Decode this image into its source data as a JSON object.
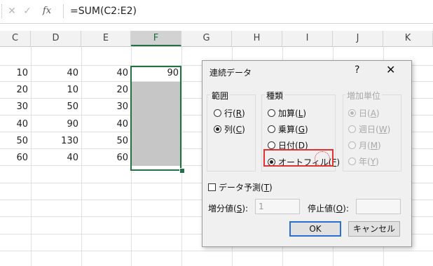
{
  "formula_bar": {
    "cancel_icon": "x-icon",
    "enter_icon": "check-icon",
    "fx_label": "fx",
    "formula": "=SUM(C2:E2)"
  },
  "columns": [
    "C",
    "D",
    "E",
    "F",
    "G",
    "H",
    "I",
    "J",
    "K"
  ],
  "selected_column": "F",
  "rows": [
    {
      "c": "10",
      "d": "40",
      "e": "40",
      "f": "90"
    },
    {
      "c": "20",
      "d": "10",
      "e": "20",
      "f": ""
    },
    {
      "c": "30",
      "d": "50",
      "e": "30",
      "f": ""
    },
    {
      "c": "40",
      "d": "90",
      "e": "40",
      "f": ""
    },
    {
      "c": "50",
      "d": "130",
      "e": "50",
      "f": ""
    },
    {
      "c": "60",
      "d": "40",
      "e": "60",
      "f": ""
    }
  ],
  "dialog": {
    "title": "連続データ",
    "help": "?",
    "close": "✕",
    "range_group": {
      "label": "範囲",
      "options": [
        {
          "label": "行(",
          "key": "R",
          "suffix": ")",
          "checked": false
        },
        {
          "label": "列(",
          "key": "C",
          "suffix": ")",
          "checked": true
        }
      ]
    },
    "type_group": {
      "label": "種類",
      "options": [
        {
          "label": "加算(",
          "key": "L",
          "suffix": ")",
          "checked": false
        },
        {
          "label": "乗算(",
          "key": "G",
          "suffix": ")",
          "checked": false
        },
        {
          "label": "日付(",
          "key": "D",
          "suffix": ")",
          "checked": false
        },
        {
          "label": "オートフィル(",
          "key": "F",
          "suffix": ")",
          "checked": true
        }
      ]
    },
    "unit_group": {
      "label": "増加単位",
      "options": [
        {
          "label": "日(",
          "key": "A",
          "suffix": ")",
          "checked": true
        },
        {
          "label": "週日(",
          "key": "W",
          "suffix": ")",
          "checked": false
        },
        {
          "label": "月(",
          "key": "M",
          "suffix": ")",
          "checked": false
        },
        {
          "label": "年(",
          "key": "Y",
          "suffix": ")",
          "checked": false
        }
      ]
    },
    "trend": {
      "label": "データ予測(",
      "key": "T",
      "suffix": ")",
      "checked": false
    },
    "step": {
      "label": "増分値(",
      "key": "S",
      "suffix": "):",
      "value": "1"
    },
    "stop": {
      "label": "停止値(",
      "key": "O",
      "suffix": "):",
      "value": ""
    },
    "ok_label": "OK",
    "cancel_label": "キャンセル"
  }
}
